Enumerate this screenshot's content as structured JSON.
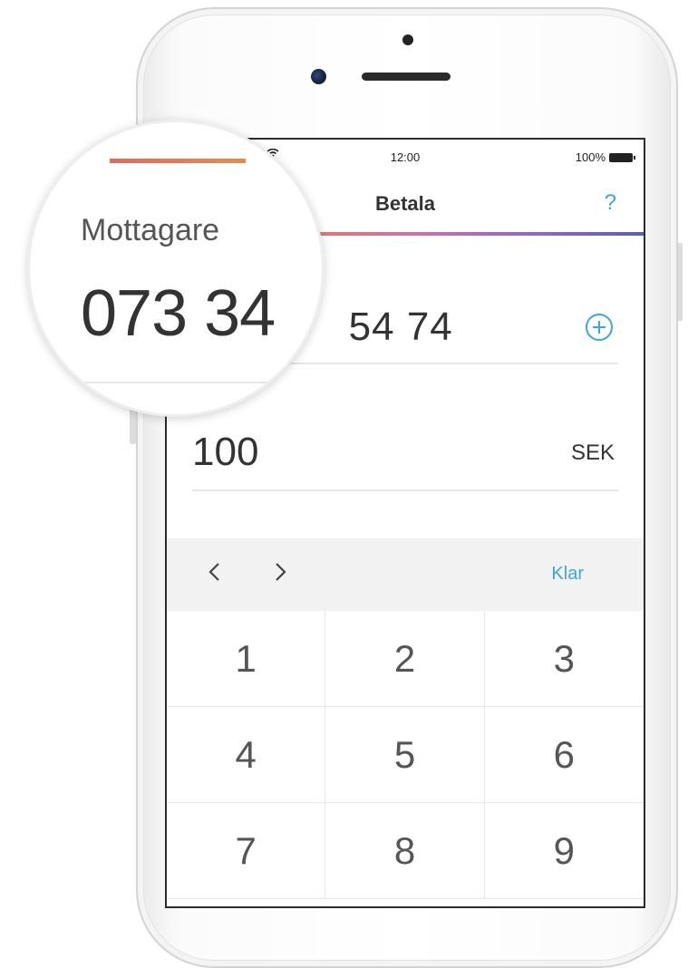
{
  "status_bar": {
    "time": "12:00",
    "battery": "100%"
  },
  "nav": {
    "title": "Betala",
    "help": "?"
  },
  "recipient": {
    "value": "073 34 54 74",
    "visible_value": " 54 74"
  },
  "amount": {
    "value": "100",
    "currency": "SEK"
  },
  "keypad_toolbar": {
    "done": "Klar"
  },
  "keys": [
    "1",
    "2",
    "3",
    "4",
    "5",
    "6",
    "7",
    "8",
    "9"
  ],
  "magnifier": {
    "label": "Mottagare",
    "value": "073 34"
  },
  "colors": {
    "accent": "#3aa8d8",
    "text": "#333333"
  }
}
